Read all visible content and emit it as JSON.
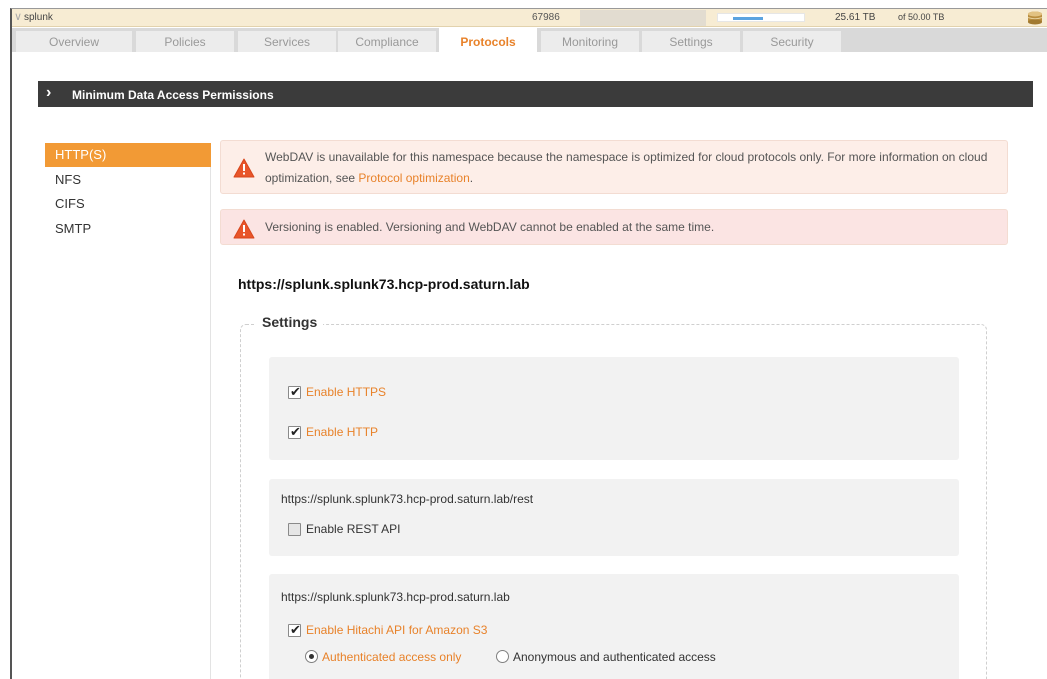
{
  "topbar": {
    "namespace": "splunk",
    "object_count": "67986",
    "used": "25.61 TB",
    "total": "of 50.00 TB",
    "usage_fraction": 0.51
  },
  "tabs": [
    {
      "label": "Overview"
    },
    {
      "label": "Policies"
    },
    {
      "label": "Services"
    },
    {
      "label": "Compliance"
    },
    {
      "label": "Protocols"
    },
    {
      "label": "Monitoring"
    },
    {
      "label": "Settings"
    },
    {
      "label": "Security"
    }
  ],
  "section": {
    "title": "Minimum Data Access Permissions"
  },
  "sidenav": [
    {
      "label": "HTTP(S)"
    },
    {
      "label": "NFS"
    },
    {
      "label": "CIFS"
    },
    {
      "label": "SMTP"
    }
  ],
  "alerts": {
    "webdav": {
      "text": "WebDAV is unavailable for this namespace because the namespace is optimized for cloud protocols only. For more information on cloud optimization, see ",
      "link": "Protocol optimization",
      "suffix": "."
    },
    "versioning": {
      "text": "Versioning is enabled. Versioning and WebDAV cannot be enabled at the same time."
    }
  },
  "url_heading": "https://splunk.splunk73.hcp-prod.saturn.lab",
  "settings": {
    "legend": "Settings",
    "enable_https": "Enable HTTPS",
    "enable_http": "Enable HTTP",
    "rest_url": "https://splunk.splunk73.hcp-prod.saturn.lab/rest",
    "enable_rest": "Enable REST API",
    "s3_url": "https://splunk.splunk73.hcp-prod.saturn.lab",
    "enable_s3": "Enable Hitachi API for Amazon S3",
    "auth_only": "Authenticated access only",
    "anon_auth": "Anonymous and authenticated access"
  },
  "colors": {
    "accent": "#e8822a",
    "section_bar": "#3b3b3b",
    "titlebar": "#f7ecd3",
    "progress": "#5ba3e0"
  }
}
